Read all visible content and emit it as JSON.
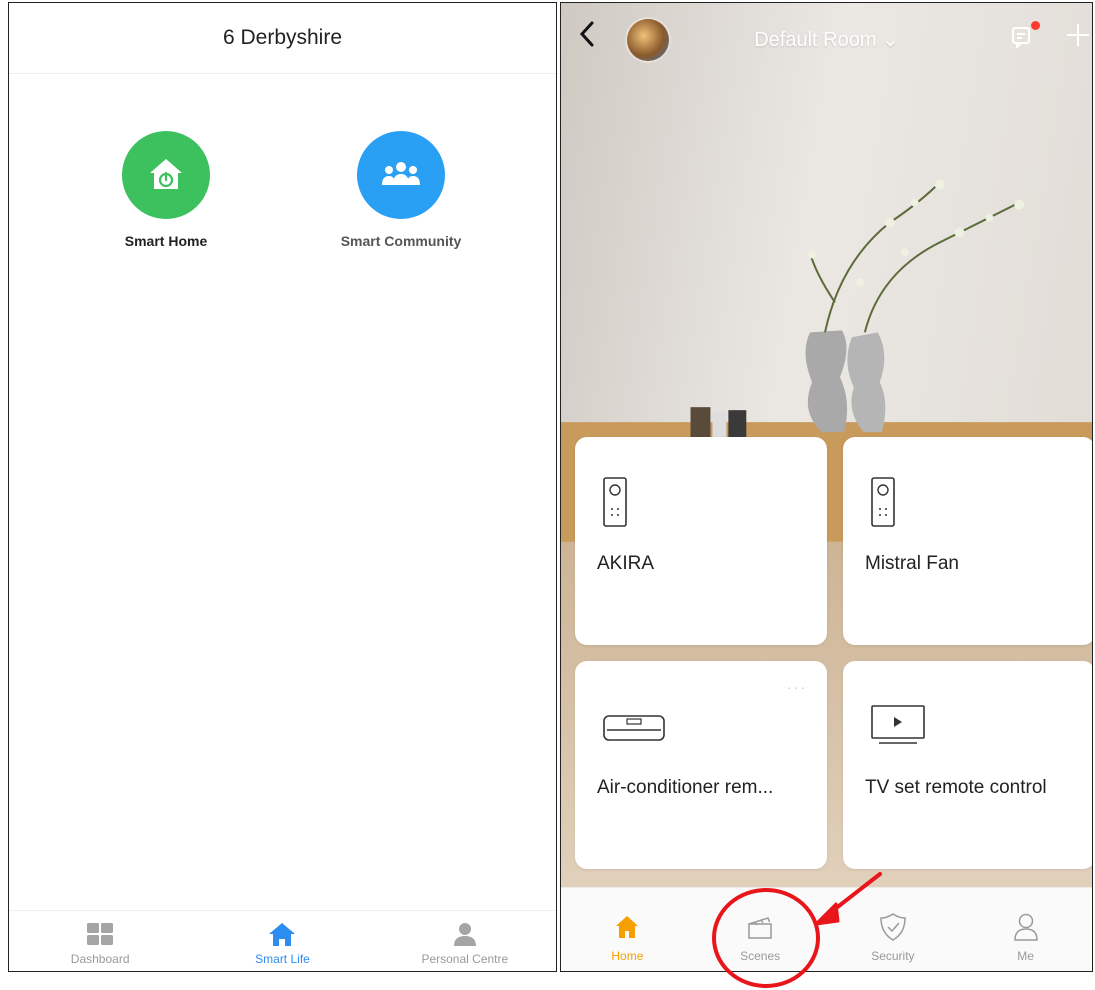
{
  "left": {
    "header_title": "6 Derbyshire",
    "apps": [
      {
        "label": "Smart Home",
        "icon": "home-power-icon",
        "color": "#3dc15f"
      },
      {
        "label": "Smart Community",
        "icon": "people-icon",
        "color": "#2aa0f5"
      }
    ],
    "tabs": [
      {
        "label": "Dashboard",
        "icon": "grid-icon",
        "active": false
      },
      {
        "label": "Smart Life",
        "icon": "home-icon",
        "active": true
      },
      {
        "label": "Personal Centre",
        "icon": "person-icon",
        "active": false
      }
    ],
    "active_color": "#2d8cf0"
  },
  "right": {
    "header": {
      "room_title": "Default Room ⌄",
      "notification_dot_color": "#ff3b30"
    },
    "devices": [
      {
        "name": "AKIRA",
        "icon": "remote-icon"
      },
      {
        "name": "Mistral Fan",
        "icon": "remote-icon"
      },
      {
        "name": "Air-conditioner rem...",
        "icon": "air-conditioner-icon",
        "menu": "···"
      },
      {
        "name": "TV set remote control",
        "icon": "tv-icon"
      }
    ],
    "tabs": [
      {
        "label": "Home",
        "icon": "home-icon",
        "active": true
      },
      {
        "label": "Scenes",
        "icon": "clapperboard-icon",
        "active": false
      },
      {
        "label": "Security",
        "icon": "shield-check-icon",
        "active": false
      },
      {
        "label": "Me",
        "icon": "person-icon",
        "active": false
      }
    ],
    "active_color": "#f5a000",
    "annotation_color": "#e8151b"
  }
}
